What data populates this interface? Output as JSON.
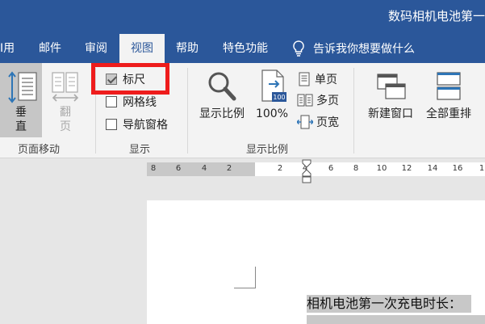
{
  "title_bar": {
    "doc_title": "数码相机电池第一"
  },
  "tabs": [
    {
      "label": "I用"
    },
    {
      "label": "邮件"
    },
    {
      "label": "审阅"
    },
    {
      "label": "视图"
    },
    {
      "label": "帮助"
    },
    {
      "label": "特色功能"
    }
  ],
  "active_tab": "视图",
  "tell_me": {
    "label": "告诉我你想要做什么",
    "icon": "lightbulb-icon"
  },
  "ribbon": {
    "page_movement": {
      "group_label": "页面移动",
      "vertical": {
        "line1": "垂",
        "line2": "直",
        "icon": "vertical-page-icon",
        "selected": true
      },
      "side_to_side": {
        "line1": "翻",
        "line2": "页",
        "icon": "side-by-side-icon",
        "enabled": false
      }
    },
    "show": {
      "group_label": "显示",
      "ruler": {
        "label": "标尺",
        "checked": true
      },
      "gridlines": {
        "label": "网格线",
        "checked": false
      },
      "nav_pane": {
        "label": "导航窗格",
        "checked": false
      }
    },
    "zoom": {
      "group_label": "显示比例",
      "zoom_btn": {
        "label": "显示比例",
        "icon": "magnifier-icon"
      },
      "hundred_btn": {
        "label": "100%",
        "badge": "100",
        "icon": "zoom-100-icon"
      },
      "one_page": {
        "label": "单页",
        "icon": "one-page-icon"
      },
      "multi_page": {
        "label": "多页",
        "icon": "multiple-pages-icon"
      },
      "page_width": {
        "label": "页宽",
        "icon": "page-width-icon"
      }
    },
    "window": {
      "new_window": {
        "label": "新建窗口",
        "icon": "new-window-icon"
      },
      "arrange_all": {
        "label": "全部重排",
        "icon": "arrange-all-icon"
      }
    }
  },
  "ruler": {
    "left_ticks": [
      "8",
      "6",
      "4",
      "2"
    ],
    "right_ticks": [
      "2",
      "4",
      "6",
      "8",
      "10",
      "12",
      "14",
      "16",
      "1"
    ]
  },
  "document": {
    "first_line": "相机电池第一次充电时长："
  },
  "colors": {
    "accent": "#2b579a",
    "highlight": "#ee1c1c"
  }
}
